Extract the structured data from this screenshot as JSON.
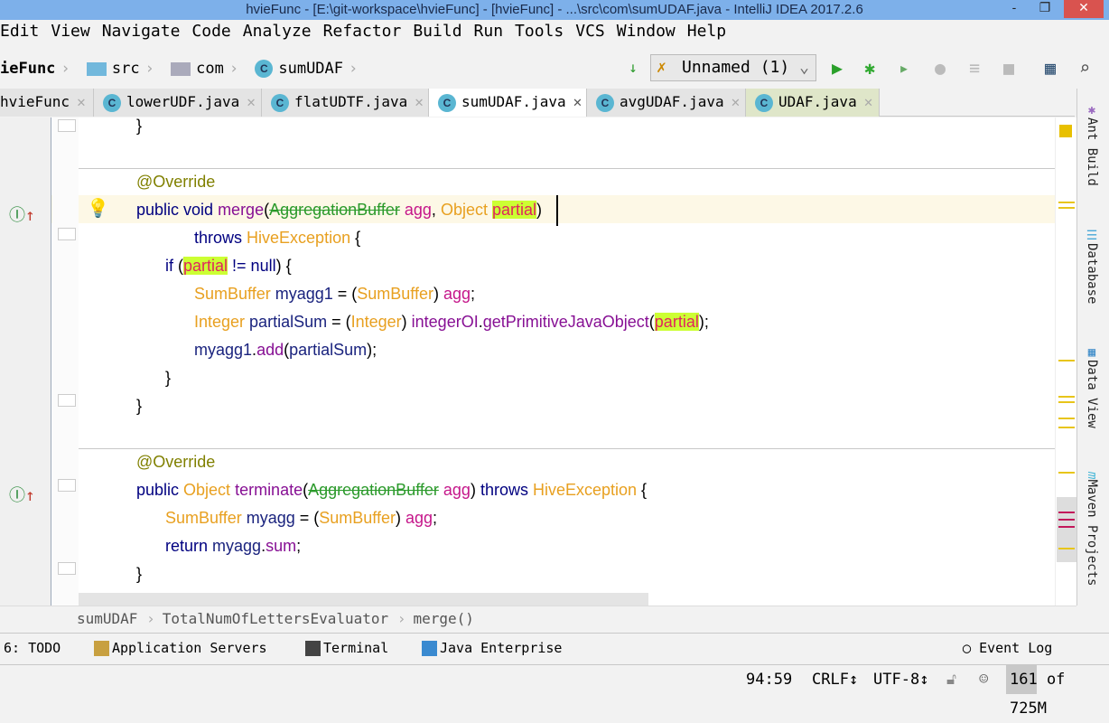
{
  "window": {
    "title": "hvieFunc - [E:\\git-workspace\\hvieFunc] - [hvieFunc] - ...\\src\\com\\sumUDAF.java - IntelliJ IDEA 2017.2.6",
    "minimize": "-",
    "restore": "❐",
    "close": "✕"
  },
  "menu": [
    "Edit",
    "View",
    "Navigate",
    "Code",
    "Analyze",
    "Refactor",
    "Build",
    "Run",
    "Tools",
    "VCS",
    "Window",
    "Help"
  ],
  "navbar": {
    "crumbs": [
      "ieFunc",
      "src",
      "com",
      "sumUDAF"
    ],
    "run_config": "Unnamed (1)"
  },
  "tabs": [
    {
      "label": "hvieFunc"
    },
    {
      "label": "lowerUDF.java"
    },
    {
      "label": "flatUDTF.java"
    },
    {
      "label": "sumUDAF.java",
      "active": true
    },
    {
      "label": "avgUDAF.java"
    },
    {
      "label": "UDAF.java"
    }
  ],
  "code_lines": [
    [
      [
        "plain",
        "}"
      ]
    ],
    [],
    [
      [
        "ann",
        "@Override"
      ]
    ],
    [
      [
        "kw",
        "public void "
      ],
      [
        "method",
        "merge"
      ],
      [
        "plain",
        "("
      ],
      [
        "dep",
        "AggregationBuffer"
      ],
      [
        "param",
        " agg"
      ],
      [
        "plain",
        ", "
      ],
      [
        "type",
        "Object "
      ],
      [
        "hl",
        "partial"
      ],
      [
        "plain",
        ")"
      ]
    ],
    [
      [
        "kw",
        "throws "
      ],
      [
        "type",
        "HiveException"
      ],
      [
        "plain",
        " {"
      ]
    ],
    [
      [
        "kw",
        "if "
      ],
      [
        "plain",
        "("
      ],
      [
        "hl",
        "partial"
      ],
      [
        "kw",
        " != null"
      ],
      [
        "plain",
        ") {"
      ]
    ],
    [
      [
        "type",
        "SumBuffer"
      ],
      [
        "var",
        " myagg1"
      ],
      [
        "plain",
        " = ("
      ],
      [
        "type",
        "SumBuffer"
      ],
      [
        "plain",
        ") "
      ],
      [
        "param",
        "agg"
      ],
      [
        "plain",
        ";"
      ]
    ],
    [
      [
        "type",
        "Integer"
      ],
      [
        "var",
        " partialSum"
      ],
      [
        "plain",
        " = ("
      ],
      [
        "type",
        "Integer"
      ],
      [
        "plain",
        ") "
      ],
      [
        "field",
        "integerOI"
      ],
      [
        "plain",
        "."
      ],
      [
        "method",
        "getPrimitiveJavaObject"
      ],
      [
        "plain",
        "("
      ],
      [
        "hl",
        "partial"
      ],
      [
        "plain",
        ");"
      ]
    ],
    [
      [
        "var",
        "myagg1"
      ],
      [
        "plain",
        "."
      ],
      [
        "method",
        "add"
      ],
      [
        "plain",
        "("
      ],
      [
        "var",
        "partialSum"
      ],
      [
        "plain",
        ");"
      ]
    ],
    [
      [
        "plain",
        "}"
      ]
    ],
    [
      [
        "plain",
        "}"
      ]
    ],
    [],
    [
      [
        "ann",
        "@Override"
      ]
    ],
    [
      [
        "kw",
        "public "
      ],
      [
        "type",
        "Object "
      ],
      [
        "method",
        "terminate"
      ],
      [
        "plain",
        "("
      ],
      [
        "dep",
        "AggregationBuffer"
      ],
      [
        "param",
        " agg"
      ],
      [
        "plain",
        ") "
      ],
      [
        "kw",
        "throws "
      ],
      [
        "type",
        "HiveException"
      ],
      [
        "plain",
        " {"
      ]
    ],
    [
      [
        "type",
        "SumBuffer"
      ],
      [
        "var",
        " myagg"
      ],
      [
        "plain",
        " = ("
      ],
      [
        "type",
        "SumBuffer"
      ],
      [
        "plain",
        ") "
      ],
      [
        "param",
        "agg"
      ],
      [
        "plain",
        ";"
      ]
    ],
    [
      [
        "kw",
        "return "
      ],
      [
        "var",
        "myagg"
      ],
      [
        "plain",
        "."
      ],
      [
        "field",
        "sum"
      ],
      [
        "plain",
        ";"
      ]
    ],
    [
      [
        "plain",
        "}"
      ]
    ]
  ],
  "code_indent": [
    0,
    0,
    0,
    0,
    2,
    1,
    2,
    2,
    2,
    1,
    0,
    0,
    0,
    0,
    1,
    1,
    0
  ],
  "right_tools": [
    "Ant Build",
    "Database",
    "Data View",
    "Maven Projects"
  ],
  "editor_breadcrumb": [
    "sumUDAF",
    "TotalNumOfLettersEvaluator",
    "merge()"
  ],
  "tool_windows": [
    "6: TODO",
    "Application Servers",
    "Terminal",
    "Java Enterprise",
    "Event Log"
  ],
  "status": {
    "position": "94:59",
    "line_sep": "CRLF",
    "encoding": "UTF-8",
    "memory": "161 of 725M"
  }
}
